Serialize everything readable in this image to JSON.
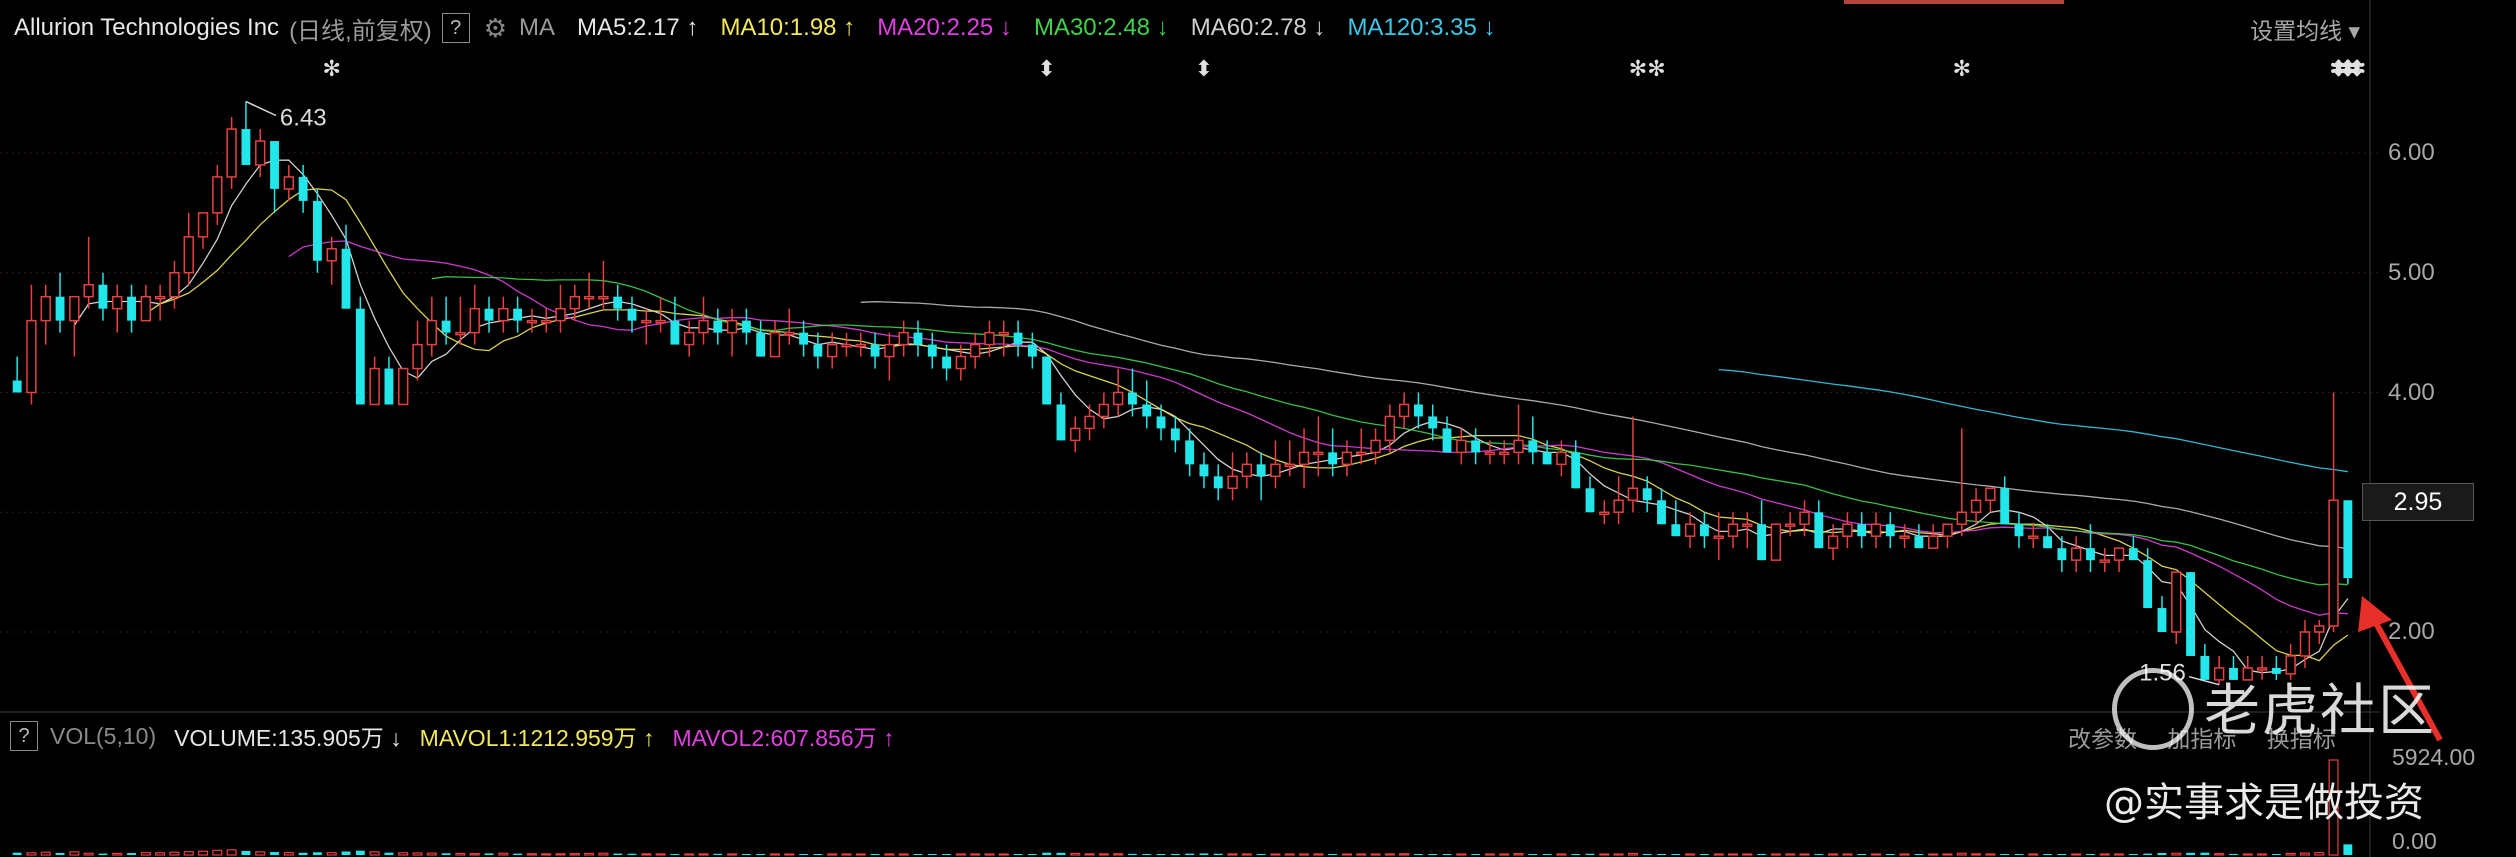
{
  "header": {
    "title": "Allurion Technologies Inc",
    "subtitle": "(日线,前复权)",
    "help": "?",
    "ma_label": "MA",
    "ma_items": [
      {
        "label": "MA5:2.17",
        "arrow": "↑",
        "color": "#e6e6e6"
      },
      {
        "label": "MA10:1.98",
        "arrow": "↑",
        "color": "#f2e85a"
      },
      {
        "label": "MA20:2.25",
        "arrow": "↓",
        "color": "#e040e0"
      },
      {
        "label": "MA30:2.48",
        "arrow": "↓",
        "color": "#3fd24a"
      },
      {
        "label": "MA60:2.78",
        "arrow": "↓",
        "color": "#d0d0d0"
      },
      {
        "label": "MA120:3.35",
        "arrow": "↓",
        "color": "#3cc8e8"
      }
    ],
    "settings_label": "设置均线"
  },
  "price_axis": {
    "ticks": [
      "6.00",
      "5.00",
      "4.00",
      "3.00",
      "2.00"
    ],
    "current_price": "2.95"
  },
  "volume_panel": {
    "help": "?",
    "label": "VOL(5,10)",
    "volume": "VOLUME:135.905万",
    "volume_arrow": "↓",
    "mavol1": "MAVOL1:1212.959万",
    "mavol1_arrow": "↑",
    "mavol2": "MAVOL2:607.856万",
    "mavol2_arrow": "↑",
    "buttons": [
      "改参数",
      "加指标",
      "换指标"
    ],
    "max_label": "5924.00",
    "zero_label": "0.00"
  },
  "annotations": {
    "high_label": "6.43",
    "low_label": "1.56"
  },
  "watermark": {
    "brand": "老虎社区",
    "author": "@实事求是做投资"
  },
  "colors": {
    "up": "#e84040",
    "down": "#22e6ea",
    "background": "#000000",
    "arrow": "#e8302a"
  },
  "chart_data": {
    "type": "candlestick",
    "title": "Allurion Technologies Inc",
    "ylim": [
      1.3,
      6.9
    ],
    "y_ticks": [
      2.0,
      3.0,
      4.0,
      5.0,
      6.0
    ],
    "ohlc": [
      [
        4.1,
        4.3,
        4.0,
        4.0
      ],
      [
        4.0,
        4.9,
        3.9,
        4.6
      ],
      [
        4.6,
        4.9,
        4.4,
        4.8
      ],
      [
        4.8,
        5.0,
        4.5,
        4.6
      ],
      [
        4.6,
        4.8,
        4.3,
        4.8
      ],
      [
        4.8,
        5.3,
        4.7,
        4.9
      ],
      [
        4.9,
        5.0,
        4.6,
        4.7
      ],
      [
        4.7,
        4.9,
        4.5,
        4.8
      ],
      [
        4.8,
        4.9,
        4.5,
        4.6
      ],
      [
        4.6,
        4.9,
        4.6,
        4.8
      ],
      [
        4.8,
        4.9,
        4.6,
        4.8
      ],
      [
        4.8,
        5.1,
        4.7,
        5.0
      ],
      [
        5.0,
        5.5,
        4.9,
        5.3
      ],
      [
        5.3,
        5.5,
        5.2,
        5.5
      ],
      [
        5.5,
        5.9,
        5.4,
        5.8
      ],
      [
        5.8,
        6.3,
        5.7,
        6.2
      ],
      [
        6.2,
        6.43,
        5.9,
        5.9
      ],
      [
        5.9,
        6.2,
        5.8,
        6.1
      ],
      [
        6.1,
        6.1,
        5.5,
        5.7
      ],
      [
        5.7,
        5.9,
        5.6,
        5.8
      ],
      [
        5.8,
        5.9,
        5.5,
        5.6
      ],
      [
        5.6,
        5.7,
        5.0,
        5.1
      ],
      [
        5.1,
        5.3,
        4.9,
        5.2
      ],
      [
        5.2,
        5.4,
        4.7,
        4.7
      ],
      [
        4.7,
        4.8,
        3.9,
        3.9
      ],
      [
        3.9,
        4.3,
        3.9,
        4.2
      ],
      [
        4.2,
        4.3,
        3.9,
        3.9
      ],
      [
        3.9,
        4.2,
        3.9,
        4.2
      ],
      [
        4.2,
        4.6,
        4.1,
        4.4
      ],
      [
        4.4,
        4.8,
        4.3,
        4.6
      ],
      [
        4.6,
        4.8,
        4.4,
        4.5
      ],
      [
        4.5,
        4.8,
        4.4,
        4.5
      ],
      [
        4.5,
        4.9,
        4.4,
        4.7
      ],
      [
        4.7,
        4.8,
        4.5,
        4.6
      ],
      [
        4.6,
        4.8,
        4.5,
        4.7
      ],
      [
        4.7,
        4.8,
        4.5,
        4.6
      ],
      [
        4.6,
        4.7,
        4.5,
        4.6
      ],
      [
        4.6,
        4.7,
        4.5,
        4.6
      ],
      [
        4.6,
        4.9,
        4.5,
        4.7
      ],
      [
        4.7,
        4.9,
        4.6,
        4.8
      ],
      [
        4.8,
        5.0,
        4.7,
        4.8
      ],
      [
        4.8,
        5.1,
        4.7,
        4.8
      ],
      [
        4.8,
        4.9,
        4.6,
        4.7
      ],
      [
        4.7,
        4.8,
        4.5,
        4.6
      ],
      [
        4.6,
        4.7,
        4.4,
        4.6
      ],
      [
        4.6,
        4.8,
        4.5,
        4.6
      ],
      [
        4.6,
        4.8,
        4.5,
        4.4
      ],
      [
        4.4,
        4.6,
        4.3,
        4.5
      ],
      [
        4.5,
        4.8,
        4.4,
        4.6
      ],
      [
        4.6,
        4.7,
        4.4,
        4.5
      ],
      [
        4.5,
        4.7,
        4.3,
        4.6
      ],
      [
        4.6,
        4.7,
        4.4,
        4.5
      ],
      [
        4.5,
        4.6,
        4.3,
        4.3
      ],
      [
        4.3,
        4.6,
        4.3,
        4.5
      ],
      [
        4.5,
        4.7,
        4.4,
        4.5
      ],
      [
        4.5,
        4.6,
        4.3,
        4.4
      ],
      [
        4.4,
        4.5,
        4.2,
        4.3
      ],
      [
        4.3,
        4.5,
        4.2,
        4.4
      ],
      [
        4.4,
        4.5,
        4.3,
        4.4
      ],
      [
        4.4,
        4.5,
        4.3,
        4.4
      ],
      [
        4.4,
        4.5,
        4.2,
        4.3
      ],
      [
        4.3,
        4.5,
        4.1,
        4.4
      ],
      [
        4.4,
        4.6,
        4.3,
        4.5
      ],
      [
        4.5,
        4.6,
        4.3,
        4.4
      ],
      [
        4.4,
        4.5,
        4.2,
        4.3
      ],
      [
        4.3,
        4.4,
        4.1,
        4.2
      ],
      [
        4.2,
        4.4,
        4.1,
        4.3
      ],
      [
        4.3,
        4.5,
        4.2,
        4.4
      ],
      [
        4.4,
        4.6,
        4.3,
        4.5
      ],
      [
        4.5,
        4.6,
        4.3,
        4.5
      ],
      [
        4.5,
        4.6,
        4.3,
        4.4
      ],
      [
        4.4,
        4.5,
        4.2,
        4.3
      ],
      [
        4.3,
        4.3,
        3.9,
        3.9
      ],
      [
        3.9,
        4.0,
        3.6,
        3.6
      ],
      [
        3.6,
        3.8,
        3.5,
        3.7
      ],
      [
        3.7,
        3.9,
        3.6,
        3.8
      ],
      [
        3.8,
        4.0,
        3.7,
        3.9
      ],
      [
        3.9,
        4.2,
        3.8,
        4.0
      ],
      [
        4.0,
        4.2,
        3.8,
        3.9
      ],
      [
        3.9,
        4.1,
        3.7,
        3.8
      ],
      [
        3.8,
        3.9,
        3.6,
        3.7
      ],
      [
        3.7,
        3.8,
        3.5,
        3.6
      ],
      [
        3.6,
        3.7,
        3.3,
        3.4
      ],
      [
        3.4,
        3.5,
        3.2,
        3.3
      ],
      [
        3.3,
        3.4,
        3.1,
        3.2
      ],
      [
        3.2,
        3.5,
        3.1,
        3.3
      ],
      [
        3.3,
        3.5,
        3.2,
        3.4
      ],
      [
        3.4,
        3.5,
        3.1,
        3.3
      ],
      [
        3.3,
        3.6,
        3.2,
        3.4
      ],
      [
        3.4,
        3.6,
        3.3,
        3.4
      ],
      [
        3.4,
        3.7,
        3.2,
        3.5
      ],
      [
        3.5,
        3.8,
        3.3,
        3.5
      ],
      [
        3.5,
        3.7,
        3.3,
        3.4
      ],
      [
        3.4,
        3.6,
        3.3,
        3.5
      ],
      [
        3.5,
        3.7,
        3.4,
        3.5
      ],
      [
        3.5,
        3.7,
        3.4,
        3.6
      ],
      [
        3.6,
        3.9,
        3.5,
        3.8
      ],
      [
        3.8,
        4.0,
        3.7,
        3.9
      ],
      [
        3.9,
        4.0,
        3.7,
        3.8
      ],
      [
        3.8,
        3.9,
        3.6,
        3.7
      ],
      [
        3.7,
        3.8,
        3.5,
        3.5
      ],
      [
        3.5,
        3.7,
        3.4,
        3.6
      ],
      [
        3.6,
        3.7,
        3.4,
        3.5
      ],
      [
        3.5,
        3.6,
        3.4,
        3.5
      ],
      [
        3.5,
        3.6,
        3.4,
        3.5
      ],
      [
        3.5,
        3.9,
        3.4,
        3.6
      ],
      [
        3.6,
        3.8,
        3.4,
        3.5
      ],
      [
        3.5,
        3.6,
        3.4,
        3.4
      ],
      [
        3.4,
        3.6,
        3.3,
        3.5
      ],
      [
        3.5,
        3.6,
        3.2,
        3.2
      ],
      [
        3.2,
        3.3,
        3.0,
        3.0
      ],
      [
        3.0,
        3.1,
        2.9,
        3.0
      ],
      [
        3.0,
        3.3,
        2.9,
        3.1
      ],
      [
        3.1,
        3.8,
        3.0,
        3.2
      ],
      [
        3.2,
        3.3,
        3.0,
        3.1
      ],
      [
        3.1,
        3.2,
        2.9,
        2.9
      ],
      [
        2.9,
        3.1,
        2.8,
        2.8
      ],
      [
        2.8,
        3.0,
        2.7,
        2.9
      ],
      [
        2.9,
        3.0,
        2.7,
        2.8
      ],
      [
        2.8,
        3.0,
        2.6,
        2.8
      ],
      [
        2.8,
        3.0,
        2.7,
        2.9
      ],
      [
        2.9,
        3.0,
        2.7,
        2.9
      ],
      [
        2.9,
        3.1,
        2.6,
        2.6
      ],
      [
        2.6,
        2.9,
        2.6,
        2.9
      ],
      [
        2.9,
        3.0,
        2.8,
        2.9
      ],
      [
        2.9,
        3.1,
        2.8,
        3.0
      ],
      [
        3.0,
        3.1,
        2.7,
        2.7
      ],
      [
        2.7,
        2.9,
        2.6,
        2.8
      ],
      [
        2.8,
        3.0,
        2.7,
        2.9
      ],
      [
        2.9,
        3.0,
        2.7,
        2.8
      ],
      [
        2.8,
        3.0,
        2.7,
        2.9
      ],
      [
        2.9,
        3.0,
        2.7,
        2.8
      ],
      [
        2.8,
        2.9,
        2.7,
        2.8
      ],
      [
        2.8,
        2.9,
        2.7,
        2.7
      ],
      [
        2.7,
        2.9,
        2.7,
        2.8
      ],
      [
        2.8,
        2.9,
        2.7,
        2.9
      ],
      [
        2.9,
        3.7,
        2.8,
        3.0
      ],
      [
        3.0,
        3.2,
        2.9,
        3.1
      ],
      [
        3.1,
        3.2,
        3.0,
        3.2
      ],
      [
        3.2,
        3.3,
        2.9,
        2.9
      ],
      [
        2.9,
        3.0,
        2.7,
        2.8
      ],
      [
        2.8,
        2.9,
        2.7,
        2.8
      ],
      [
        2.8,
        2.9,
        2.7,
        2.7
      ],
      [
        2.7,
        2.8,
        2.5,
        2.6
      ],
      [
        2.6,
        2.8,
        2.5,
        2.7
      ],
      [
        2.7,
        2.9,
        2.5,
        2.6
      ],
      [
        2.6,
        2.7,
        2.5,
        2.6
      ],
      [
        2.6,
        2.7,
        2.5,
        2.7
      ],
      [
        2.7,
        2.8,
        2.6,
        2.6
      ],
      [
        2.6,
        2.7,
        2.2,
        2.2
      ],
      [
        2.2,
        2.3,
        2.0,
        2.0
      ],
      [
        2.0,
        2.5,
        1.9,
        2.5
      ],
      [
        2.5,
        2.5,
        1.8,
        1.8
      ],
      [
        1.8,
        1.9,
        1.6,
        1.6
      ],
      [
        1.6,
        1.8,
        1.56,
        1.7
      ],
      [
        1.7,
        1.8,
        1.6,
        1.6
      ],
      [
        1.6,
        1.8,
        1.6,
        1.7
      ],
      [
        1.7,
        1.8,
        1.6,
        1.7
      ],
      [
        1.7,
        1.8,
        1.6,
        1.65
      ],
      [
        1.65,
        1.9,
        1.6,
        1.8
      ],
      [
        1.8,
        2.1,
        1.7,
        2.0
      ],
      [
        2.0,
        2.1,
        1.9,
        2.05
      ],
      [
        2.05,
        4.0,
        2.0,
        3.1
      ],
      [
        3.1,
        3.1,
        2.4,
        2.45
      ]
    ],
    "volume": [
      30,
      28,
      35,
      26,
      40,
      22,
      18,
      20,
      25,
      30,
      28,
      35,
      42,
      48,
      60,
      65,
      52,
      40,
      38,
      30,
      28,
      35,
      30,
      45,
      55,
      40,
      30,
      28,
      26,
      24,
      22,
      20,
      18,
      20,
      22,
      18,
      16,
      15,
      16,
      18,
      20,
      22,
      18,
      16,
      15,
      14,
      13,
      12,
      14,
      15,
      13,
      12,
      14,
      13,
      12,
      11,
      12,
      13,
      12,
      11,
      12,
      13,
      12,
      11,
      10,
      11,
      12,
      13,
      12,
      11,
      10,
      12,
      30,
      28,
      20,
      15,
      14,
      16,
      15,
      13,
      12,
      14,
      18,
      20,
      16,
      14,
      12,
      11,
      12,
      11,
      13,
      14,
      12,
      11,
      10,
      11,
      14,
      16,
      12,
      11,
      13,
      11,
      10,
      10,
      11,
      18,
      12,
      10,
      9,
      12,
      16,
      12,
      11,
      20,
      14,
      12,
      11,
      10,
      11,
      12,
      10,
      11,
      14,
      12,
      10,
      11,
      13,
      11,
      10,
      11,
      10,
      11,
      10,
      10,
      11,
      10,
      22,
      14,
      12,
      13,
      11,
      10,
      11,
      12,
      10,
      12,
      11,
      10,
      10,
      18,
      26,
      22,
      28,
      30,
      18,
      14,
      12,
      12,
      11,
      20,
      24,
      30,
      1213,
      136
    ],
    "markers_top": [
      "✻",
      "⬍",
      "⬍",
      "✻✻",
      "✻",
      "✻",
      "✻⬍",
      "⬍",
      "✻✻",
      "⬍⬍",
      "✻",
      "✻",
      "✻",
      "✻",
      "✻",
      "⬍",
      "✻"
    ]
  }
}
